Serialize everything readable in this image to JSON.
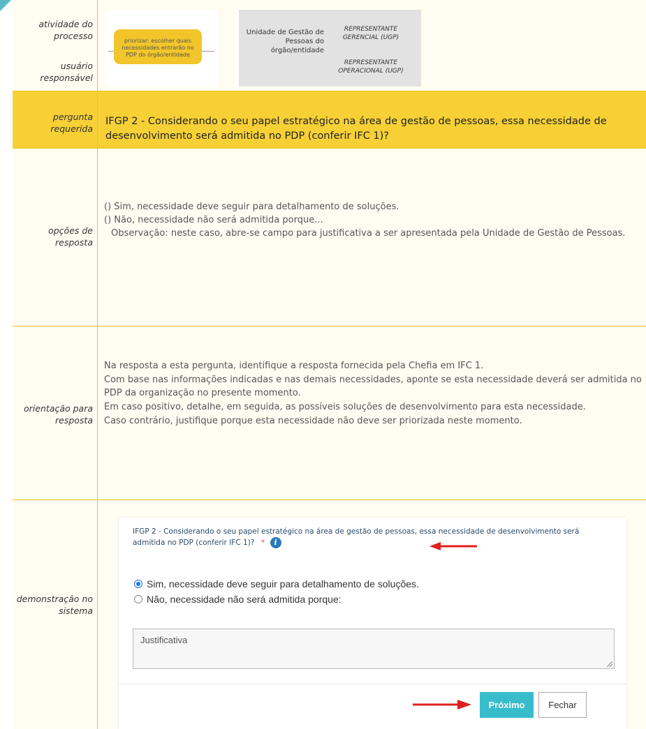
{
  "labels": {
    "atividade": "atividade do processo",
    "usuario": "usuário responsável",
    "pergunta": "pergunta requerida",
    "opcoes": "opções de resposta",
    "orientacao": "orientação para resposta",
    "demonstracao": "demonstração no sistema"
  },
  "process_diagram": {
    "activity_box": "priorizar: escolher quais necessidades entrarão no PDP do órgão/entidade",
    "unit": "Unidade de Gestão de Pessoas do órgão/entidade",
    "rep_gerencial": "REPRESENTANTE GERENCIAL (UGP)",
    "rep_operacional": "REPRESENTANTE OPERACIONAL (UGP)"
  },
  "question": "IFGP 2 - Considerando o seu papel estratégico na área de gestão de pessoas, essa necessidade de desenvolvimento será admitida no PDP (conferir IFC 1)?",
  "options": {
    "opt1": "() Sim, necessidade deve seguir para detalhamento de soluções.",
    "opt2": "() Não, necessidade não será admitida porque...",
    "observation": "Observação: neste caso, abre-se campo para justificativa a ser apresentada pela Unidade de Gestão de Pessoas."
  },
  "orientation": {
    "p1": "Na resposta a esta pergunta, identifique a resposta fornecida pela Chefia em IFC 1.",
    "p2": "Com base nas informações indicadas e nas demais necessidades, aponte se esta necessidade deverá ser admitida no PDP da organização no presente momento.",
    "p3": "Em caso positivo, detalhe, em seguida, as possíveis soluções de desenvolvimento para esta necessidade.",
    "p4": "Caso contrário, justifique porque esta necessidade não deve ser priorizada neste momento."
  },
  "demo": {
    "question": "IFGP 2 - Considerando o seu papel estratégico na área de gestão de pessoas, essa necessidade de desenvolvimento será admitida no PDP (conferir IFC 1)?",
    "required_mark": "*",
    "info_glyph": "i",
    "radio_yes": "Sim, necessidade deve seguir para detalhamento de soluções.",
    "radio_no": "Não, necessidade não será admitida porque:",
    "selected": "yes",
    "textarea_placeholder": "Justificativa",
    "next_button": "Próximo",
    "close_button": "Fechar"
  },
  "colors": {
    "border": "#f0c419",
    "highlight_row": "#f6d035",
    "button_primary": "#37bccc",
    "arrow": "#e0201c"
  }
}
